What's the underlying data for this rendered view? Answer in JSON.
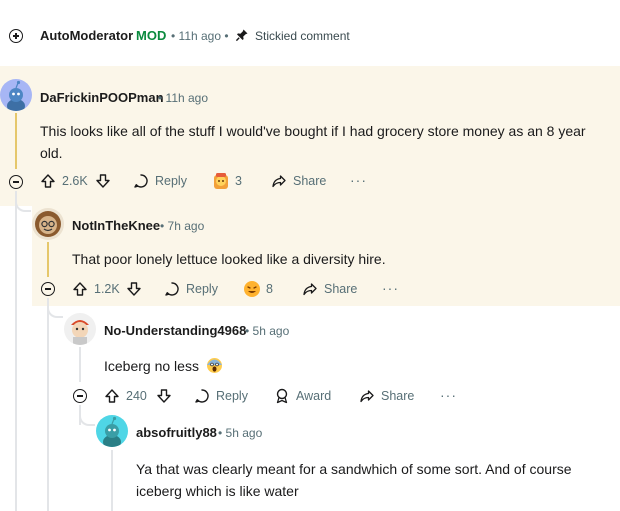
{
  "automod": {
    "username": "AutoModerator",
    "mod_badge": "MOD",
    "time": "• 11h ago •",
    "stickied": "Stickied comment"
  },
  "comments": [
    {
      "username": "DaFrickinPOOPman",
      "time": "• 11h ago",
      "body": "This looks like all of the stuff I would've bought if I had grocery store money as an 8 year old.",
      "votes": "2.6K",
      "reply": "Reply",
      "award_count": "3",
      "share": "Share"
    },
    {
      "username": "NotInTheKnee",
      "time": "• 7h ago",
      "body": "That poor lonely lettuce looked like a diversity hire.",
      "votes": "1.2K",
      "reply": "Reply",
      "award_count": "8",
      "share": "Share"
    },
    {
      "username": "No-Understanding4968",
      "time": "• 5h ago",
      "body": "Iceberg no less",
      "votes": "240",
      "reply": "Reply",
      "award": "Award",
      "share": "Share"
    },
    {
      "username": "absofruitly88",
      "time": "• 5h ago",
      "body": "Ya that was clearly meant for a sandwhich of some sort. And of course iceberg which is like water"
    }
  ],
  "colors": {
    "highlight": "#fbf6e9",
    "thread_gold": "#e5c76b",
    "thread_gray": "#e3e5e8",
    "mod_green": "#0a8a3e",
    "meta_gray": "#576f76"
  }
}
